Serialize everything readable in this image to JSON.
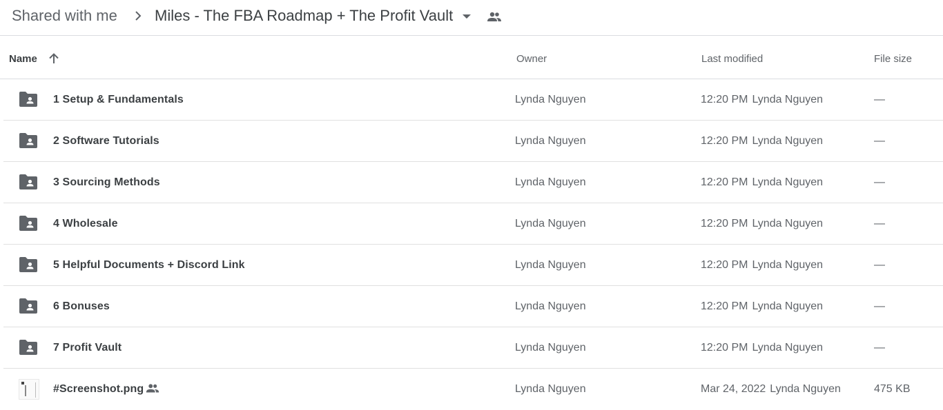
{
  "breadcrumb": {
    "root": "Shared with me",
    "current": "Miles - The FBA Roadmap + The Profit Vault"
  },
  "columns": {
    "name": "Name",
    "owner": "Owner",
    "last_modified": "Last modified",
    "file_size": "File size"
  },
  "colors": {
    "folder_icon": "#5f6368",
    "divider": "#dadce0"
  },
  "files": [
    {
      "type": "shared-folder",
      "name": "1 Setup & Fundamentals",
      "owner": "Lynda Nguyen",
      "modified": "12:20 PM",
      "modified_by": "Lynda Nguyen",
      "size": "—"
    },
    {
      "type": "shared-folder",
      "name": "2 Software Tutorials",
      "owner": "Lynda Nguyen",
      "modified": "12:20 PM",
      "modified_by": "Lynda Nguyen",
      "size": "—"
    },
    {
      "type": "shared-folder",
      "name": "3 Sourcing Methods",
      "owner": "Lynda Nguyen",
      "modified": "12:20 PM",
      "modified_by": "Lynda Nguyen",
      "size": "—"
    },
    {
      "type": "shared-folder",
      "name": "4 Wholesale",
      "owner": "Lynda Nguyen",
      "modified": "12:20 PM",
      "modified_by": "Lynda Nguyen",
      "size": "—"
    },
    {
      "type": "shared-folder",
      "name": "5 Helpful Documents + Discord Link",
      "owner": "Lynda Nguyen",
      "modified": "12:20 PM",
      "modified_by": "Lynda Nguyen",
      "size": "—"
    },
    {
      "type": "shared-folder",
      "name": "6 Bonuses",
      "owner": "Lynda Nguyen",
      "modified": "12:20 PM",
      "modified_by": "Lynda Nguyen",
      "size": "—"
    },
    {
      "type": "shared-folder",
      "name": "7 Profit Vault",
      "owner": "Lynda Nguyen",
      "modified": "12:20 PM",
      "modified_by": "Lynda Nguyen",
      "size": "—"
    },
    {
      "type": "image",
      "name": "#Screenshot.png",
      "shared": true,
      "owner": "Lynda Nguyen",
      "modified": "Mar 24, 2022",
      "modified_by": "Lynda Nguyen",
      "size": "475 KB"
    }
  ]
}
